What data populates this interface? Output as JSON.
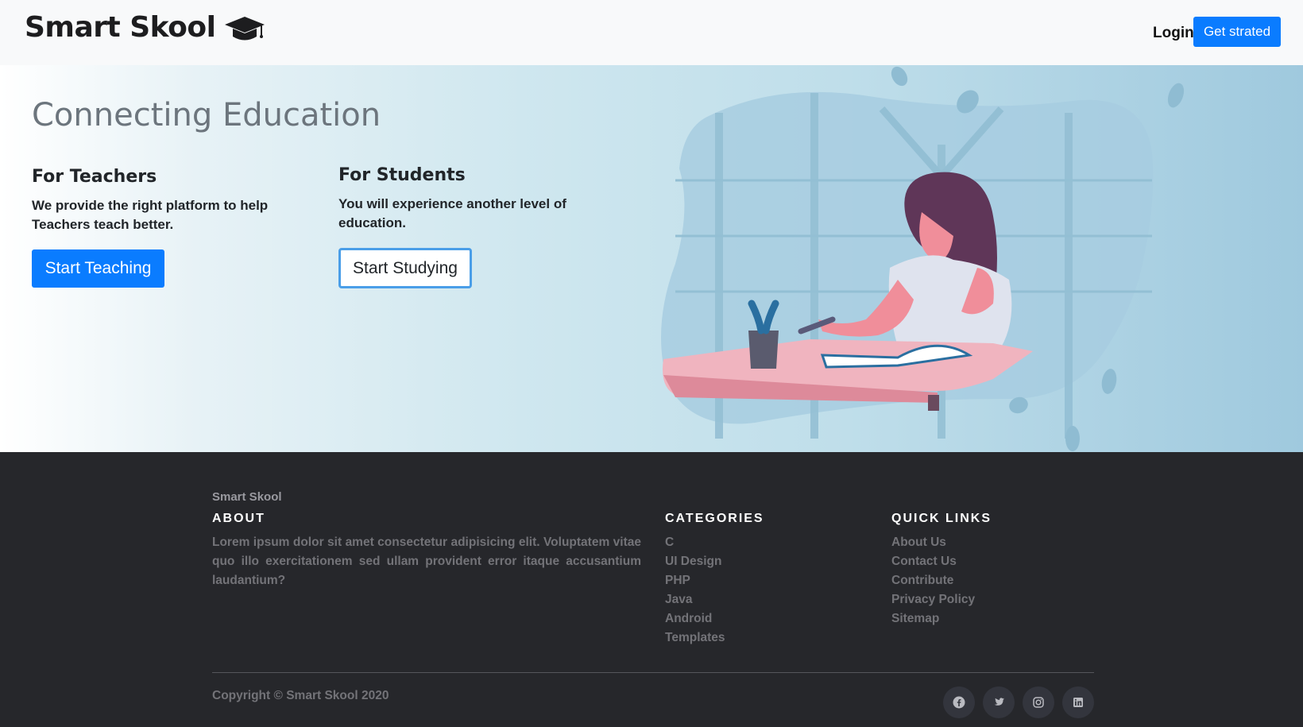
{
  "navbar": {
    "brand": "Smart Skool",
    "login": "Login",
    "cta": "Get strated"
  },
  "hero": {
    "title": "Connecting Education",
    "teachers": {
      "title": "For Teachers",
      "text": "We provide the right platform to help Teachers teach better.",
      "button": "Start Teaching"
    },
    "students": {
      "title": "For Students",
      "text": "You will experience another level of education.",
      "button": "Start Studying"
    }
  },
  "footer": {
    "brand": "Smart Skool",
    "about": {
      "heading": "ABOUT",
      "text": "Lorem ipsum dolor sit amet consectetur adipisicing elit. Voluptatem vitae quo illo exercitationem sed ullam provident error itaque accusantium laudantium?"
    },
    "categories": {
      "heading": "CATEGORIES",
      "items": [
        "C",
        "UI Design",
        "PHP",
        "Java",
        "Android",
        "Templates"
      ]
    },
    "quick_links": {
      "heading": "QUICK LINKS",
      "items": [
        "About Us",
        "Contact Us",
        "Contribute",
        "Privacy Policy",
        "Sitemap"
      ]
    },
    "copyright": "Copyright © Smart Skool 2020",
    "socials": [
      "facebook-icon",
      "twitter-icon",
      "instagram-icon",
      "linkedin-icon"
    ]
  },
  "colors": {
    "primary": "#0a7cff",
    "footer_bg": "#26272b",
    "navbar_bg": "#f8f9fa"
  }
}
